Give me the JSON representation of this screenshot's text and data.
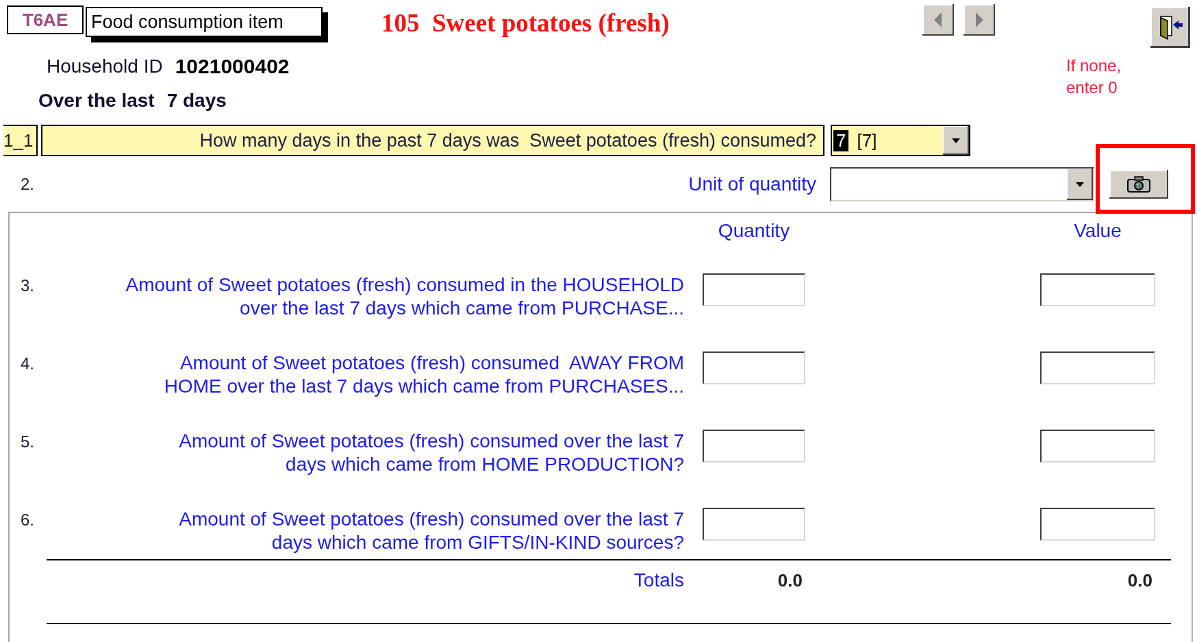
{
  "form_code": "T6AE",
  "form_title": "Food consumption item",
  "item_title": "105  Sweet potatoes (fresh)",
  "nav_buttons": [
    {
      "kind": "previous"
    },
    {
      "kind": "next"
    }
  ],
  "household": {
    "label": "Household ID",
    "value": "1021000402"
  },
  "period": {
    "label": "Over the last",
    "value": "7 days"
  },
  "note": [
    "If none,",
    "enter 0"
  ],
  "question_1": {
    "number": "1_1",
    "text": "How many days in the past 7 days was  Sweet potatoes (fresh) consumed?",
    "value": "7",
    "code": "[7]",
    "value_highlighted": true
  },
  "question_2": {
    "number": "2.",
    "label": "Unit of quantity",
    "camera_highlighted": true
  },
  "columns": [
    "Quantity",
    "Value"
  ],
  "rows": [
    {
      "number": "3.",
      "lines": [
        "Amount of Sweet potatoes (fresh) consumed in the HOUSEHOLD",
        "over the last 7 days which came from PURCHASE..."
      ]
    },
    {
      "number": "4.",
      "lines": [
        "Amount of Sweet potatoes (fresh) consumed  AWAY FROM",
        "HOME over the last 7 days which came from PURCHASES..."
      ]
    },
    {
      "number": "5.",
      "lines": [
        "Amount of Sweet potatoes (fresh) consumed over the last 7",
        "days which came from HOME PRODUCTION?"
      ]
    },
    {
      "number": "6.",
      "lines": [
        "Amount of Sweet potatoes (fresh) consumed over the last 7",
        "days which came from GIFTS/IN-KIND sources?"
      ]
    }
  ],
  "totals": {
    "label": "Totals",
    "quantity": "0.0",
    "value": "0.0"
  }
}
